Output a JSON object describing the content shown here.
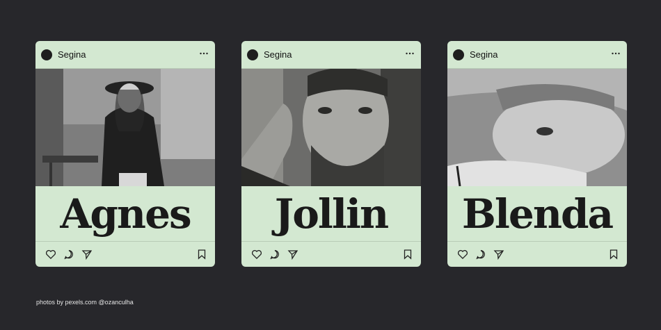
{
  "posts": [
    {
      "username": "Segina",
      "name": "Agnes"
    },
    {
      "username": "Segina",
      "name": "Jollin"
    },
    {
      "username": "Segina",
      "name": "Blenda"
    }
  ],
  "footer": {
    "credit": "photos by pexels.com @ozanculha"
  },
  "icons": [
    "more-icon",
    "heart-icon",
    "comment-icon",
    "share-icon",
    "bookmark-icon"
  ],
  "colors": {
    "background": "#27272b",
    "card": "#d3e8d1",
    "text": "#1a1a1a"
  }
}
